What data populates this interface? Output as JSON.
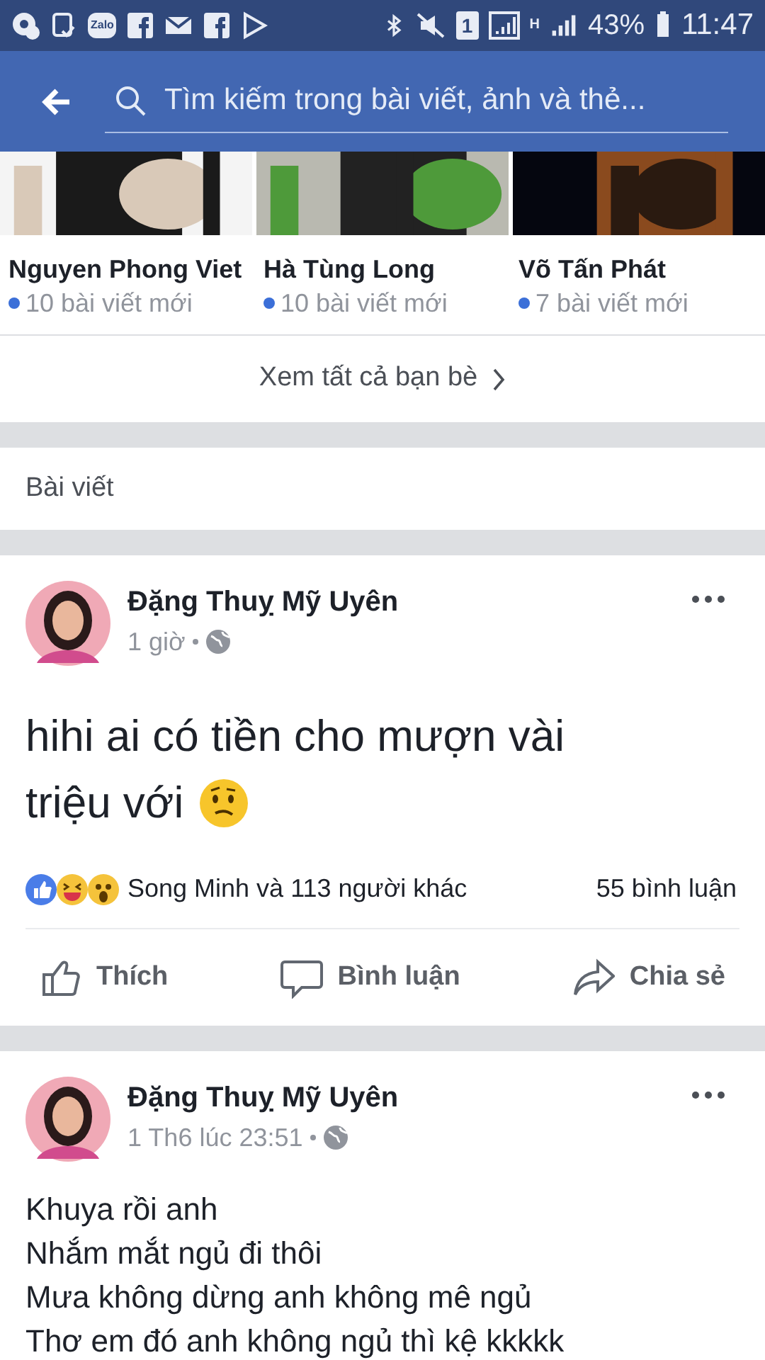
{
  "status_bar": {
    "zalo_label": "Zalo",
    "sim_label": "1",
    "network_label": "H",
    "battery": "43%",
    "time": "11:47"
  },
  "app_bar": {
    "search": {
      "placeholder": "Tìm kiếm trong bài viết, ảnh và thẻ..."
    }
  },
  "friends": [
    {
      "name": "Nguyen Phong Viet",
      "count": "10 bài viết mới",
      "color": "#3b6fd8"
    },
    {
      "name": "Hà Tùng Long",
      "count": "10 bài viết mới",
      "color": "#3b6fd8"
    },
    {
      "name": "Võ Tấn Phát",
      "count": "7 bài viết mới",
      "color": "#3b6fd8"
    }
  ],
  "see_all": "Xem tất cả bạn bè",
  "section_title": "Bài viết",
  "posts": [
    {
      "author": "Đặng Thuỵ Mỹ Uyên",
      "time": "1 giờ",
      "large": true,
      "lines": [
        "hihi ai có tiền cho mượn vài",
        "triệu với"
      ],
      "emoji": true,
      "reactions": "Song Minh và 113 người khác",
      "comments": "55 bình luận",
      "actions": [
        "Thích",
        "Bình luận",
        "Chia sẻ"
      ]
    },
    {
      "author": "Đặng Thuỵ Mỹ Uyên",
      "time": "1 Th6 lúc 23:51",
      "large": false,
      "lines": [
        "Khuya rồi anh",
        "Nhắm mắt ngủ đi thôi",
        "Mưa không dừng anh không mê ngủ",
        "Thơ em đó anh không ngủ thì kệ kkkkk"
      ],
      "emoji": false
    }
  ]
}
